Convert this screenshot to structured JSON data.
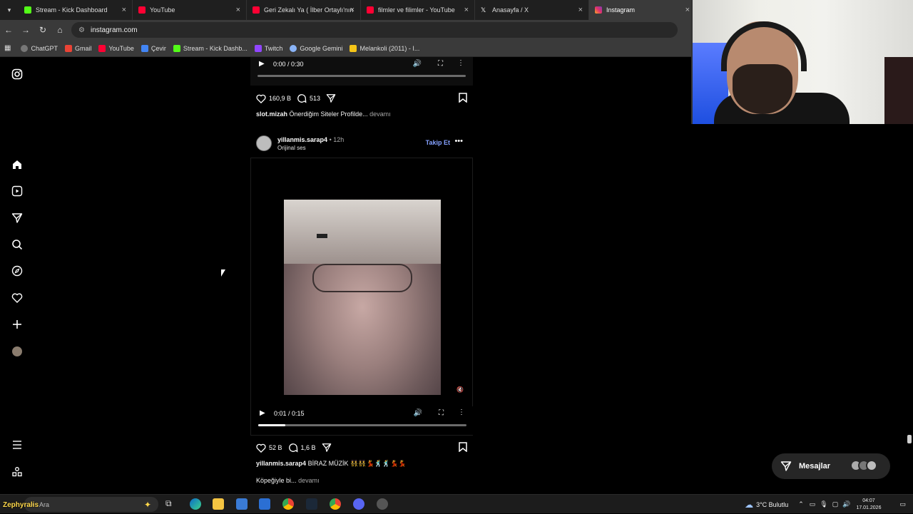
{
  "browser": {
    "tabs": [
      {
        "label": "Stream - Kick Dashboard",
        "icon": "kick-icon",
        "color": "#53fc18"
      },
      {
        "label": "YouTube",
        "icon": "youtube-icon",
        "color": "#ff0033"
      },
      {
        "label": "Geri Zekalı Ya ( İlber Ortaylı'nın",
        "icon": "youtube-icon",
        "color": "#ff0033"
      },
      {
        "label": "filmler ve filimler - YouTube",
        "icon": "youtube-icon",
        "color": "#ff0033"
      },
      {
        "label": "Anasayfa / X",
        "icon": "x-icon",
        "color": "#ffffff"
      },
      {
        "label": "Instagram",
        "icon": "instagram-icon",
        "color": "#e1306c"
      }
    ],
    "url": "instagram.com",
    "bookmarks": [
      {
        "label": "ChatGPT",
        "icon": "chatgpt-icon"
      },
      {
        "label": "Gmail",
        "icon": "gmail-icon"
      },
      {
        "label": "YouTube",
        "icon": "youtube-icon"
      },
      {
        "label": "Çevir",
        "icon": "translate-icon"
      },
      {
        "label": "Stream - Kick Dashb...",
        "icon": "kick-icon"
      },
      {
        "label": "Twitch",
        "icon": "twitch-icon"
      },
      {
        "label": "Google Gemini",
        "icon": "gemini-icon"
      },
      {
        "label": "Melankoli (2011) - I...",
        "icon": "imdb-icon"
      }
    ]
  },
  "post1": {
    "video_time": "0:00 / 0:30",
    "progress": 0.0,
    "likes": "160,9 B",
    "comments": "513",
    "caption_user": "slot.mizah",
    "caption_text": "Önerdiğim Siteler Profilde...",
    "more": "devamı"
  },
  "post2": {
    "username": "yillanmis.sarap4",
    "time": "• 12h",
    "audio": "Orijinal ses",
    "follow": "Takip Et",
    "video_time": "0:01 / 0:15",
    "progress": 0.13,
    "likes": "52 B",
    "comments": "1,6 B",
    "caption_user": "yillanmis.sarap4",
    "caption_text": "BİRAZ MÜZİK 👯👯💃🕺🕺💃💃",
    "caption_line2": "Köpeğiyle bi...",
    "more": "devamı"
  },
  "messages": {
    "label": "Mesajlar"
  },
  "taskbar": {
    "overlay_name": "Zephyralis",
    "search_text": "Ara",
    "weather": "3°C  Bulutlu",
    "time": "04:07",
    "date": "17.01.2026"
  }
}
